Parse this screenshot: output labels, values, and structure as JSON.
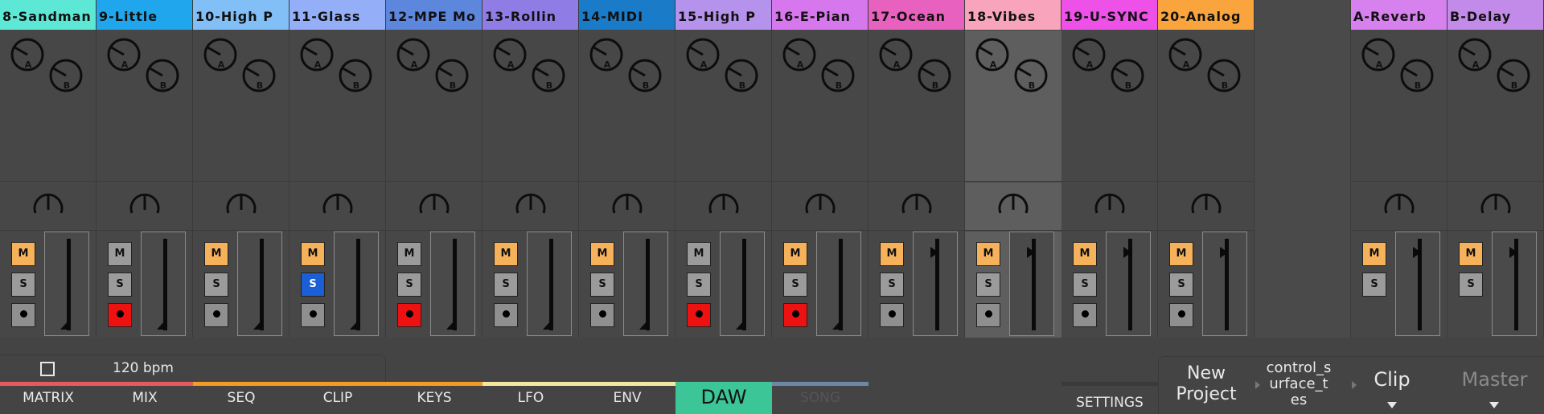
{
  "tracks": [
    {
      "name": "8-Sandman",
      "color": "#5de8d6",
      "mute": true,
      "solo": false,
      "rec": false,
      "fader": "bottom"
    },
    {
      "name": "9-Little",
      "color": "#1fa6ec",
      "mute": false,
      "solo": false,
      "rec": true,
      "fader": "bottom"
    },
    {
      "name": "10-High P",
      "color": "#83bff7",
      "mute": true,
      "solo": false,
      "rec": false,
      "fader": "bottom"
    },
    {
      "name": "11-Glass",
      "color": "#94aef8",
      "mute": true,
      "solo": true,
      "rec": false,
      "fader": "bottom"
    },
    {
      "name": "12-MPE Mo",
      "color": "#5d86dd",
      "mute": false,
      "solo": false,
      "rec": true,
      "fader": "bottom"
    },
    {
      "name": "13-Rollin",
      "color": "#8f7de5",
      "mute": true,
      "solo": false,
      "rec": false,
      "fader": "bottom"
    },
    {
      "name": "14-MIDI",
      "color": "#1a7bc8",
      "mute": true,
      "solo": false,
      "rec": false,
      "fader": "bottom"
    },
    {
      "name": "15-High P",
      "color": "#b592ec",
      "mute": false,
      "solo": false,
      "rec": true,
      "fader": "bottom"
    },
    {
      "name": "16-E-Pian",
      "color": "#d777ee",
      "mute": true,
      "solo": false,
      "rec": true,
      "fader": "bottom"
    },
    {
      "name": "17-Ocean",
      "color": "#e961be",
      "mute": true,
      "solo": false,
      "rec": false,
      "fader": "top"
    },
    {
      "name": "18-Vibes",
      "color": "#f7a4bc",
      "mute": true,
      "solo": false,
      "rec": false,
      "fader": "top",
      "selected": true
    },
    {
      "name": "19-U-SYNC",
      "color": "#ed51e8",
      "mute": true,
      "solo": false,
      "rec": false,
      "fader": "top"
    },
    {
      "name": "20-Analog",
      "color": "#f9a43c",
      "mute": true,
      "solo": false,
      "rec": false,
      "fader": "top"
    }
  ],
  "fx_tracks": [
    {
      "name": "A-Reverb",
      "color": "#d681ee",
      "mute": true,
      "solo": false,
      "fader": "top"
    },
    {
      "name": "B-Delay",
      "color": "#c38be9",
      "mute": true,
      "solo": false,
      "fader": "top"
    }
  ],
  "knob_labels": {
    "a": "A",
    "b": "B"
  },
  "buttons": {
    "mute": "M",
    "solo": "S"
  },
  "transport": {
    "tempo": "120 bpm"
  },
  "tabs": [
    {
      "label": "MATRIX",
      "color": "#e85a5a"
    },
    {
      "label": "MIX",
      "color": "#e85a5a"
    },
    {
      "label": "SEQ",
      "color": "#f59a22"
    },
    {
      "label": "CLIP",
      "color": "#f59a22"
    },
    {
      "label": "KEYS",
      "color": "#f59a22"
    },
    {
      "label": "LFO",
      "color": "#f3e8a0"
    },
    {
      "label": "ENV",
      "color": "#f3e8a0"
    },
    {
      "label": "DAW",
      "color": "#3cc596",
      "active": true
    },
    {
      "label": "SONG",
      "color": "#6e87a6",
      "dim": true
    }
  ],
  "settings_label": "SETTINGS",
  "nav": {
    "new_project": "New\nProject",
    "control_surface": "control_s\nurface_t\nes",
    "clip": "Clip",
    "master": "Master"
  }
}
